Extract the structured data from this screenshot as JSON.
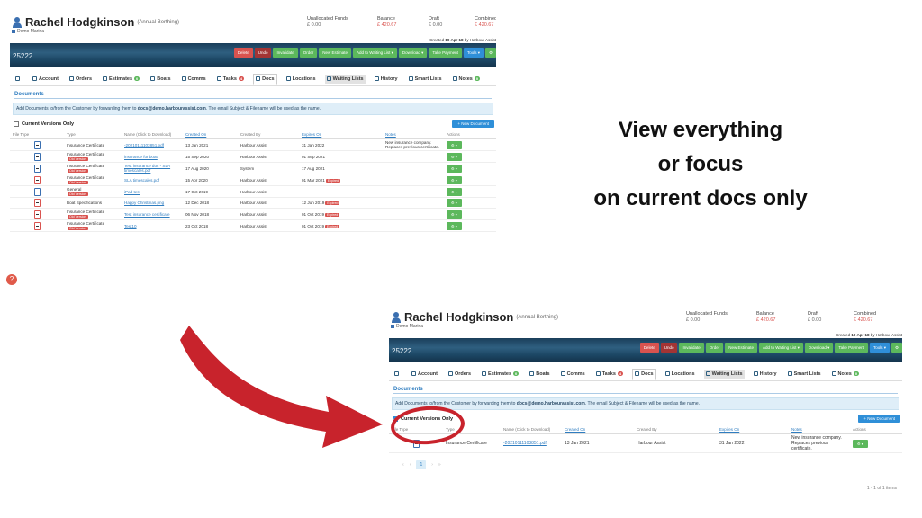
{
  "customer": {
    "name": "Rachel Hodgkinson",
    "subtitle": "(Annual Berthing)",
    "marina": "Demo Marina"
  },
  "figures": [
    {
      "label": "Unallocated Funds",
      "value": "£ 0.00",
      "red": false
    },
    {
      "label": "Balance",
      "value": "£ 420.67",
      "red": true
    },
    {
      "label": "Draft",
      "value": "£ 0.00",
      "red": false
    },
    {
      "label": "Combined",
      "value": "£ 420.67",
      "red": true
    }
  ],
  "created": {
    "prefix": "Created ",
    "date": "10 Apr 18",
    "by": " by Harbour Assist"
  },
  "record_number": "25222",
  "toolbar": [
    "Delete",
    "Undo",
    "Invalidate",
    "Order",
    "New Estimate",
    "Add to Waiting List ▾",
    "Download ▾",
    "Take Payment",
    "Tools ▾",
    "⚙"
  ],
  "tabs": [
    {
      "label": "",
      "icon": "eye-icon",
      "badge": ""
    },
    {
      "label": "Account",
      "icon": "person-icon",
      "badge": ""
    },
    {
      "label": "Orders",
      "icon": "cart-icon",
      "badge": ""
    },
    {
      "label": "Estimates",
      "icon": "doc-icon",
      "badge": "0"
    },
    {
      "label": "Boats",
      "icon": "boat-icon",
      "badge": ""
    },
    {
      "label": "Comms",
      "icon": "chat-icon",
      "badge": ""
    },
    {
      "label": "Tasks",
      "icon": "task-icon",
      "badge": "4"
    },
    {
      "label": "Docs",
      "icon": "file-icon",
      "badge": "",
      "active": true
    },
    {
      "label": "Locations",
      "icon": "location-icon",
      "badge": ""
    },
    {
      "label": "Waiting Lists",
      "icon": "list-icon",
      "badge": "",
      "highlight": true
    },
    {
      "label": "History",
      "icon": "clock-icon",
      "badge": ""
    },
    {
      "label": "Smart Lists",
      "icon": "bulb-icon",
      "badge": ""
    },
    {
      "label": "Notes",
      "icon": "note-icon",
      "badge": "0"
    }
  ],
  "docs": {
    "title": "Documents",
    "info_prefix": "Add Documents to/from the Customer by forwarding them to ",
    "info_email": "docs@demo.harbourassist.com",
    "info_suffix": ". The email Subject & Filename will be used as the name.",
    "current_only_label": "Current Versions Only",
    "new_document_label": "+ New Document",
    "columns": [
      "File Type",
      "Type",
      "Name (Click to Download)",
      "Created On",
      "Created By",
      "Expires On",
      "Notes",
      "Actions"
    ],
    "rows_all": [
      {
        "type": "Insurance Certificate",
        "tag": "",
        "name": "-20210111103851.pdf",
        "created": "13 Jan 2021",
        "by": "Harbour Assist",
        "expires": "31 Jan 2022",
        "exp_tag": "",
        "notes": "New insurance company. Replaces previous certificate.",
        "red": false
      },
      {
        "type": "Insurance Certificate",
        "tag": "Old Version",
        "name": "insurance for boat",
        "created": "15 Sep 2020",
        "by": "Harbour Assist",
        "expires": "01 Sep 2021",
        "exp_tag": "",
        "notes": "",
        "red": false
      },
      {
        "type": "Insurance Certificate",
        "tag": "Old Version",
        "name": "Test insurance doc - SLA timescales.pdf",
        "created": "17 Aug 2020",
        "by": "System",
        "expires": "17 Aug 2021",
        "exp_tag": "",
        "notes": "",
        "red": false
      },
      {
        "type": "Insurance Certificate",
        "tag": "Old Version",
        "name": "SLA timescales.pdf",
        "created": "15 Apr 2020",
        "by": "Harbour Assist",
        "expires": "01 Mar 2021",
        "exp_tag": "Expired",
        "notes": "",
        "red": true
      },
      {
        "type": "General",
        "tag": "Old Version",
        "name": "iPad test",
        "created": "17 Oct 2019",
        "by": "Harbour Assist",
        "expires": "",
        "exp_tag": "",
        "notes": "",
        "red": false
      },
      {
        "type": "Boat Specifications",
        "tag": "",
        "name": "Happy Christmas.png",
        "created": "12 Dec 2018",
        "by": "Harbour Assist",
        "expires": "12 Jun 2019",
        "exp_tag": "Expired",
        "notes": "",
        "red": true
      },
      {
        "type": "Insurance Certificate",
        "tag": "Old Version",
        "name": "Test insurance certificate",
        "created": "06 Nov 2018",
        "by": "Harbour Assist",
        "expires": "01 Oct 2019",
        "exp_tag": "Expired",
        "notes": "",
        "red": true
      },
      {
        "type": "Insurance Certificate",
        "tag": "Old Version",
        "name": "Test10",
        "created": "23 Oct 2018",
        "by": "Harbour Assist",
        "expires": "01 Oct 2019",
        "exp_tag": "Expired",
        "notes": "",
        "red": true
      }
    ],
    "rows_current": [
      {
        "type": "Insurance Certificate",
        "tag": "",
        "name": "-20210111103851.pdf",
        "created": "13 Jan 2021",
        "by": "Harbour Assist",
        "expires": "31 Jan 2022",
        "exp_tag": "",
        "notes": "New insurance company. Replaces previous certificate.",
        "red": false
      }
    ],
    "action_label": "⚙ ▾",
    "pager": [
      "«",
      "‹",
      "1",
      "›",
      "»"
    ],
    "count_text": "1 - 1 of 1 items"
  },
  "caption": [
    "View everything",
    "or focus",
    "on current docs only"
  ],
  "colors": {
    "annotation_red": "#c8232c",
    "accent_blue": "#2f7dc0",
    "success_green": "#5cb85c",
    "danger_red": "#d9534f"
  }
}
